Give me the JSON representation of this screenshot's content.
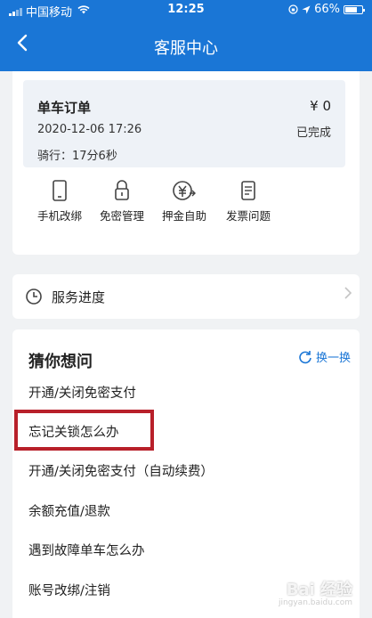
{
  "status_bar": {
    "carrier": "中国移动",
    "time": "12:25",
    "battery": "66%"
  },
  "nav": {
    "title": "客服中心",
    "back_icon": "chevron-left-icon"
  },
  "order": {
    "title": "单车订单",
    "amount": "¥ 0",
    "date": "2020-12-06 17:26",
    "status": "已完成",
    "ride": "骑行：17分6秒"
  },
  "shortcuts": [
    {
      "label": "手机改绑",
      "icon": "phone-icon"
    },
    {
      "label": "免密管理",
      "icon": "lock-icon"
    },
    {
      "label": "押金自助",
      "icon": "yuan-icon"
    },
    {
      "label": "发票问题",
      "icon": "document-icon"
    }
  ],
  "service_progress": {
    "label": "服务进度",
    "icon": "clock-icon"
  },
  "faq": {
    "heading": "猜你想问",
    "refresh_label": "换一换",
    "items": [
      "开通/关闭免密支付",
      "忘记关锁怎么办",
      "开通/关闭免密支付（自动续费）",
      "余额充值/退款",
      "遇到故障单车怎么办",
      "账号改绑/注销"
    ],
    "highlight_color": "#b8202a"
  },
  "colors": {
    "header": "#1a76d6",
    "accent": "#1a76d6",
    "background": "#f0f2f4"
  },
  "watermark": {
    "text": "Bai 经验",
    "sub": "jingyan.baidu.com"
  }
}
